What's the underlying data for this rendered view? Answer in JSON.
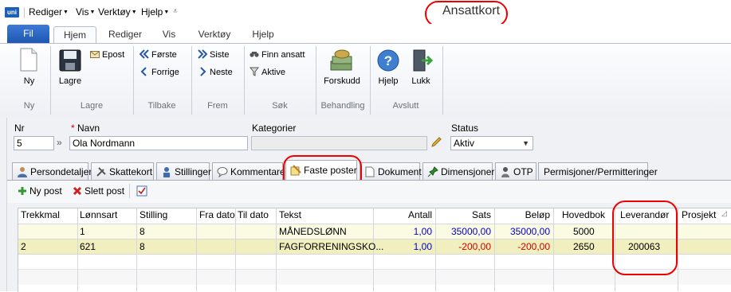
{
  "app": {
    "icon_text": "uni",
    "title": "Ansattkort"
  },
  "quick_access": [
    "Rediger",
    "Vis",
    "Verktøy",
    "Hjelp"
  ],
  "ribbon_tabs": [
    "Fil",
    "Hjem",
    "Rediger",
    "Vis",
    "Verktøy",
    "Hjelp"
  ],
  "ribbon": {
    "groups": {
      "ny": {
        "label": "Ny",
        "buttons": {
          "ny": "Ny"
        }
      },
      "lagre": {
        "label": "Lagre",
        "buttons": {
          "lagre": "Lagre",
          "epost": "Epost"
        }
      },
      "tilbake": {
        "label": "Tilbake",
        "buttons": {
          "forste": "Første",
          "forrige": "Forrige"
        }
      },
      "frem": {
        "label": "Frem",
        "buttons": {
          "siste": "Siste",
          "neste": "Neste"
        }
      },
      "sok": {
        "label": "Søk",
        "buttons": {
          "finn": "Finn ansatt",
          "aktive": "Aktive"
        }
      },
      "behandling": {
        "label": "Behandling",
        "buttons": {
          "forskudd": "Forskudd"
        }
      },
      "avslutt": {
        "label": "Avslutt",
        "buttons": {
          "hjelp": "Hjelp",
          "lukk": "Lukk"
        }
      }
    }
  },
  "form": {
    "nr_label": "Nr",
    "nr_value": "5",
    "required_mark": "*",
    "navn_label": "Navn",
    "navn_value": "Ola Nordmann",
    "kategorier_label": "Kategorier",
    "kategorier_value": "",
    "status_label": "Status",
    "status_value": "Aktiv"
  },
  "record_tabs": [
    "Persondetaljer",
    "Skattekort",
    "Stillinger",
    "Kommentarer",
    "Faste poster",
    "Dokument",
    "Dimensjoner",
    "OTP",
    "Permisjoner/Permitteringer"
  ],
  "active_tab": "Faste poster",
  "toolbar": {
    "ny_post": "Ny post",
    "slett_post": "Slett post"
  },
  "grid": {
    "columns": [
      "Trekkmal",
      "Lønnsart",
      "Stilling",
      "Fra dato",
      "Til dato",
      "Tekst",
      "Antall",
      "Sats",
      "Beløp",
      "Hovedbok",
      "Leverandør",
      "Prosjekt"
    ],
    "rows": [
      {
        "trekkmal": "",
        "lonnsart": "1",
        "stilling": "8",
        "fra": "",
        "til": "",
        "tekst": "MÅNEDSLØNN",
        "antall": "1,00",
        "sats": "35000,00",
        "belop": "35000,00",
        "hovedbok": "5000",
        "leverandor": "",
        "prosjekt": ""
      },
      {
        "trekkmal": "2",
        "lonnsart": "621",
        "stilling": "8",
        "fra": "",
        "til": "",
        "tekst": "FAGFORRENINGSKO...",
        "antall": "1,00",
        "sats": "-200,00",
        "belop": "-200,00",
        "hovedbok": "2650",
        "leverandor": "200063",
        "prosjekt": ""
      }
    ]
  },
  "colors": {
    "accent": "#1f57b2",
    "highlight_ring": "#e00000",
    "row_highlight": "#f6f3c4",
    "positive": "#0000cc",
    "negative": "#cc0000"
  }
}
